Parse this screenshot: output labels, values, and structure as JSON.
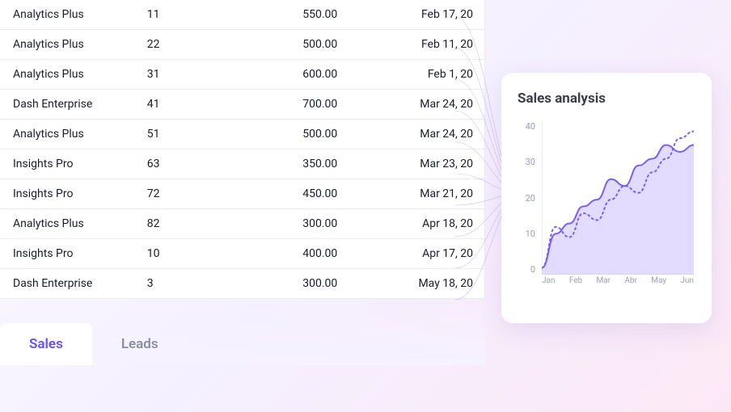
{
  "table": {
    "rows": [
      {
        "product": "Analytics Plus",
        "qty": "11",
        "amount": "550.00",
        "date": "Feb 17, 20"
      },
      {
        "product": "Analytics Plus",
        "qty": "22",
        "amount": "500.00",
        "date": "Feb 11, 20"
      },
      {
        "product": "Analytics Plus",
        "qty": "31",
        "amount": "600.00",
        "date": "Feb 1, 20"
      },
      {
        "product": "Dash Enterprise",
        "qty": "41",
        "amount": "700.00",
        "date": "Mar 24, 20"
      },
      {
        "product": "Analytics Plus",
        "qty": "51",
        "amount": "500.00",
        "date": "Mar 24, 20"
      },
      {
        "product": "Insights Pro",
        "qty": "63",
        "amount": "350.00",
        "date": "Mar 23, 20"
      },
      {
        "product": "Insights Pro",
        "qty": "72",
        "amount": "450.00",
        "date": "Mar 21, 20"
      },
      {
        "product": "Analytics Plus",
        "qty": "82",
        "amount": "300.00",
        "date": "Apr 18, 20"
      },
      {
        "product": "Insights Pro",
        "qty": "10",
        "amount": "400.00",
        "date": "Apr 17, 20"
      },
      {
        "product": "Dash Enterprise",
        "qty": "3",
        "amount": "300.00",
        "date": "May 18, 20"
      }
    ]
  },
  "tabs": {
    "sales": "Sales",
    "leads": "Leads"
  },
  "chart": {
    "title": "Sales analysis"
  },
  "chart_data": {
    "type": "area",
    "title": "Sales analysis",
    "xlabel": "",
    "ylabel": "",
    "ylim": [
      0,
      45
    ],
    "categories": [
      "Jan",
      "Feb",
      "Mar",
      "Abr",
      "May",
      "Jun"
    ],
    "yticks": [
      0,
      10,
      20,
      30,
      40
    ],
    "series": [
      {
        "name": "solid",
        "style": "solid-area",
        "values": [
          2,
          12,
          15,
          20,
          22,
          28,
          26,
          32,
          34,
          38,
          36,
          38
        ]
      },
      {
        "name": "dotted",
        "style": "dotted",
        "values": [
          2,
          14,
          11,
          18,
          16,
          22,
          26,
          24,
          30,
          34,
          40,
          42
        ]
      }
    ],
    "colors": {
      "solid": "#7b5cff",
      "area": "#c9baff",
      "dotted": "#7b5cff"
    }
  }
}
